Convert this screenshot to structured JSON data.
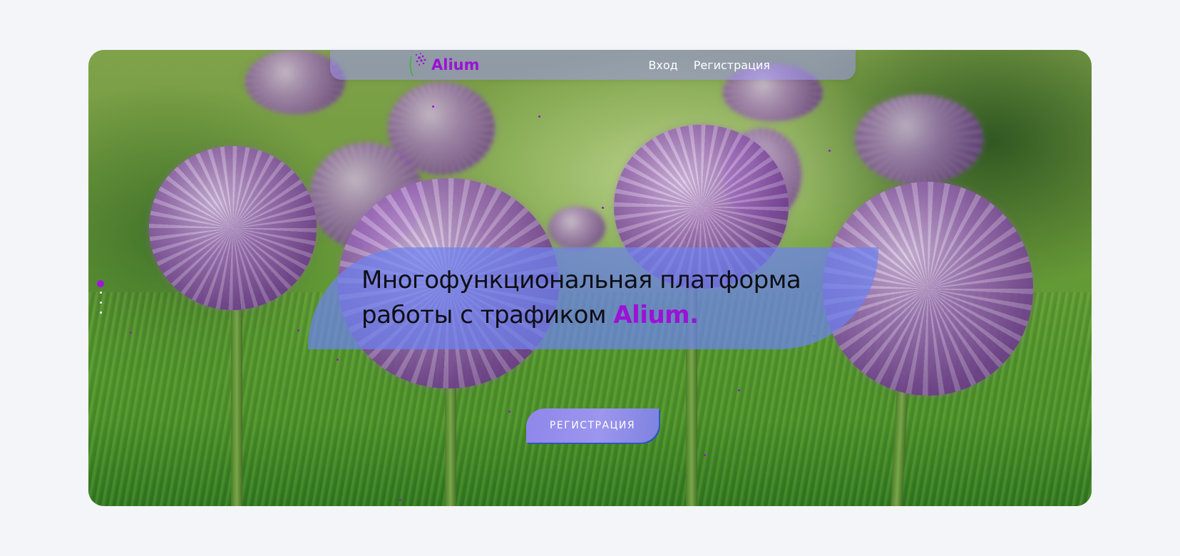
{
  "app": {
    "logo_text": "Alium",
    "accent_color": "#9b12d6"
  },
  "nav": {
    "login": "Вход",
    "register": "Регистрация"
  },
  "hero": {
    "title_line1": "Многофункциональная платформа",
    "title_line2_prefix": "работы с трафиком ",
    "title_line2_accent": "Alium."
  },
  "cta": {
    "label": "РЕГИСТРАЦИЯ"
  },
  "slider": {
    "total_slides": 4,
    "active_slide": 1
  },
  "icons": {
    "logo": "allium-flower-icon"
  }
}
